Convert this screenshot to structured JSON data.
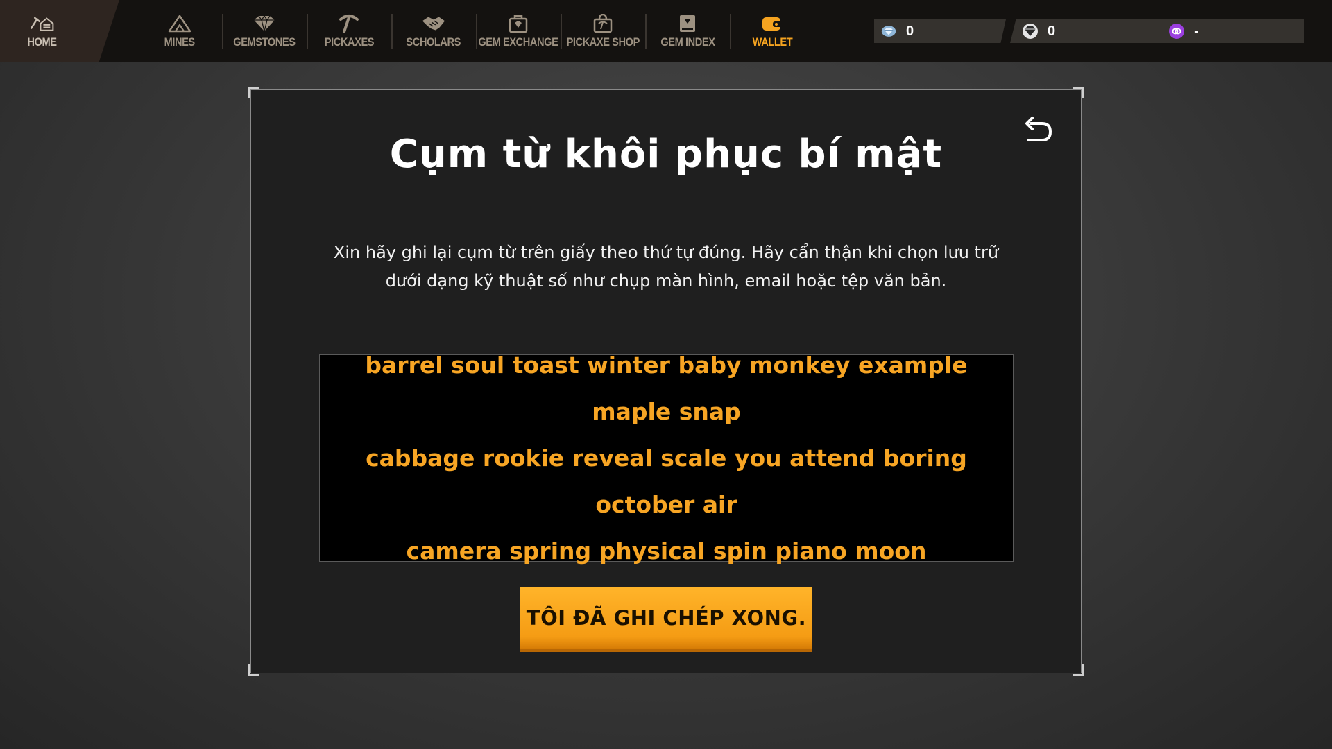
{
  "nav": {
    "home": "HOME",
    "mines": "MINES",
    "gemstones": "GEMSTONES",
    "pickaxes": "PICKAXES",
    "scholars": "SCHOLARS",
    "gem_exchange": "GEM EXCHANGE",
    "pickaxe_shop": "PICKAXE SHOP",
    "gem_index": "GEM INDEX",
    "wallet": "WALLET",
    "active": "wallet"
  },
  "balances": {
    "diamond": "0",
    "gem": "0",
    "token": "-"
  },
  "colors": {
    "accent": "#f5a320",
    "nav_inactive": "#9d9181",
    "phrase": "#f7a524",
    "token_purple": "#9b3fe0"
  },
  "dialog": {
    "title": "Cụm từ khôi phục bí mật",
    "description": "Xin hãy ghi lại cụm từ trên giấy theo thứ tự đúng. Hãy cẩn thận khi chọn lưu trữ dưới dạng kỹ thuật số như chụp màn hình, email hoặc tệp văn bản.",
    "phrase_lines": [
      "barrel soul toast winter baby monkey example maple snap",
      "cabbage rookie reveal scale you attend boring october air",
      "camera spring physical spin piano moon"
    ],
    "done_button": "TÔI ĐÃ GHI CHÉP XONG.",
    "back_icon": "undo-arrow-icon"
  }
}
